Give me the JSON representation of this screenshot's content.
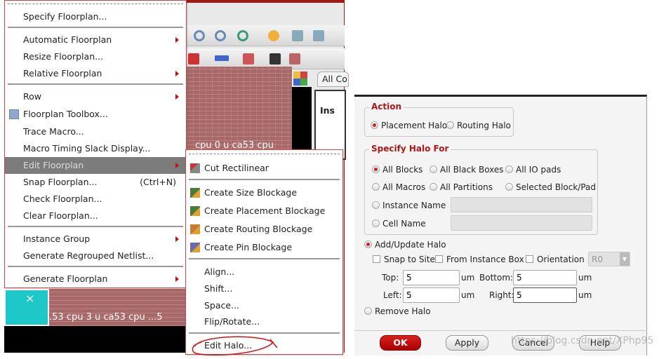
{
  "main_menu": {
    "items": [
      {
        "label": "Specify Floorplan..."
      },
      {
        "label": "Automatic Floorplan",
        "submenu": true
      },
      {
        "label": "Resize Floorplan..."
      },
      {
        "label": "Relative Floorplan",
        "submenu": true
      },
      {
        "label": "Row",
        "submenu": true
      },
      {
        "label": "Floorplan Toolbox...",
        "icon": "toolbox-icon"
      },
      {
        "label": "Trace Macro..."
      },
      {
        "label": "Macro Timing Slack Display..."
      },
      {
        "label": "Edit Floorplan",
        "submenu": true,
        "highlighted": true
      },
      {
        "label": "Snap Floorplan...",
        "shortcut": "(Ctrl+N)"
      },
      {
        "label": "Check Floorplan..."
      },
      {
        "label": "Clear Floorplan..."
      },
      {
        "label": "Instance Group",
        "submenu": true
      },
      {
        "label": "Generate Regrouped Netlist..."
      },
      {
        "label": "Generate Floorplan",
        "submenu": true
      }
    ]
  },
  "submenu": {
    "items": [
      {
        "label": "Cut Rectilinear",
        "icon": "cut-rectilinear-icon"
      },
      {
        "label": "Create Size Blockage",
        "icon": "size-blockage-icon"
      },
      {
        "label": "Create Placement Blockage",
        "icon": "placement-blockage-icon"
      },
      {
        "label": "Create Routing Blockage",
        "icon": "routing-blockage-icon"
      },
      {
        "label": "Create Pin Blockage",
        "icon": "pin-blockage-icon"
      },
      {
        "label": "Align..."
      },
      {
        "label": "Shift..."
      },
      {
        "label": "Space..."
      },
      {
        "label": "Flip/Rotate..."
      },
      {
        "label": "Edit Halo...",
        "annotated": true
      }
    ]
  },
  "background": {
    "tab_label": "All Co",
    "tree_label": "Ins",
    "canvas_text_1": "cpu 0 u ca53 cpu",
    "canvas_text_2": ".53 cpu 3 u ca53 cpu ...5"
  },
  "dialog": {
    "action": {
      "title": "Action",
      "options": [
        "Placement Halo",
        "Routing Halo"
      ],
      "selected": "Placement Halo"
    },
    "specify": {
      "title": "Specify Halo For",
      "options": [
        "All Blocks",
        "All Black Boxes",
        "All IO pads",
        "All Macros",
        "All Partitions",
        "Selected Block/Pad",
        "Instance Name",
        "Cell Name"
      ],
      "selected": "All Blocks",
      "instance_name": "",
      "cell_name": ""
    },
    "add_update": "Add/Update Halo",
    "snap_to_site": "Snap to Site",
    "from_instance_box": "From Instance Box",
    "orientation": "Orientation",
    "orientation_value": "R0",
    "top_label": "Top:",
    "top": "5",
    "bottom_label": "Bottom:",
    "bottom": "5",
    "left_label": "Left:",
    "left": "5",
    "right_label": "Right:",
    "right": "5",
    "unit": "um",
    "remove": "Remove Halo",
    "mode_selected": "Add/Update Halo",
    "buttons": {
      "ok": "OK",
      "apply": "Apply",
      "cancel": "Cancel",
      "help": "Help"
    }
  },
  "watermark": "https://blog.csdn.net/XPhp95",
  "colors": {
    "accent": "#b01818",
    "highlight": "#7b7b7b",
    "annotation": "#d01010"
  }
}
